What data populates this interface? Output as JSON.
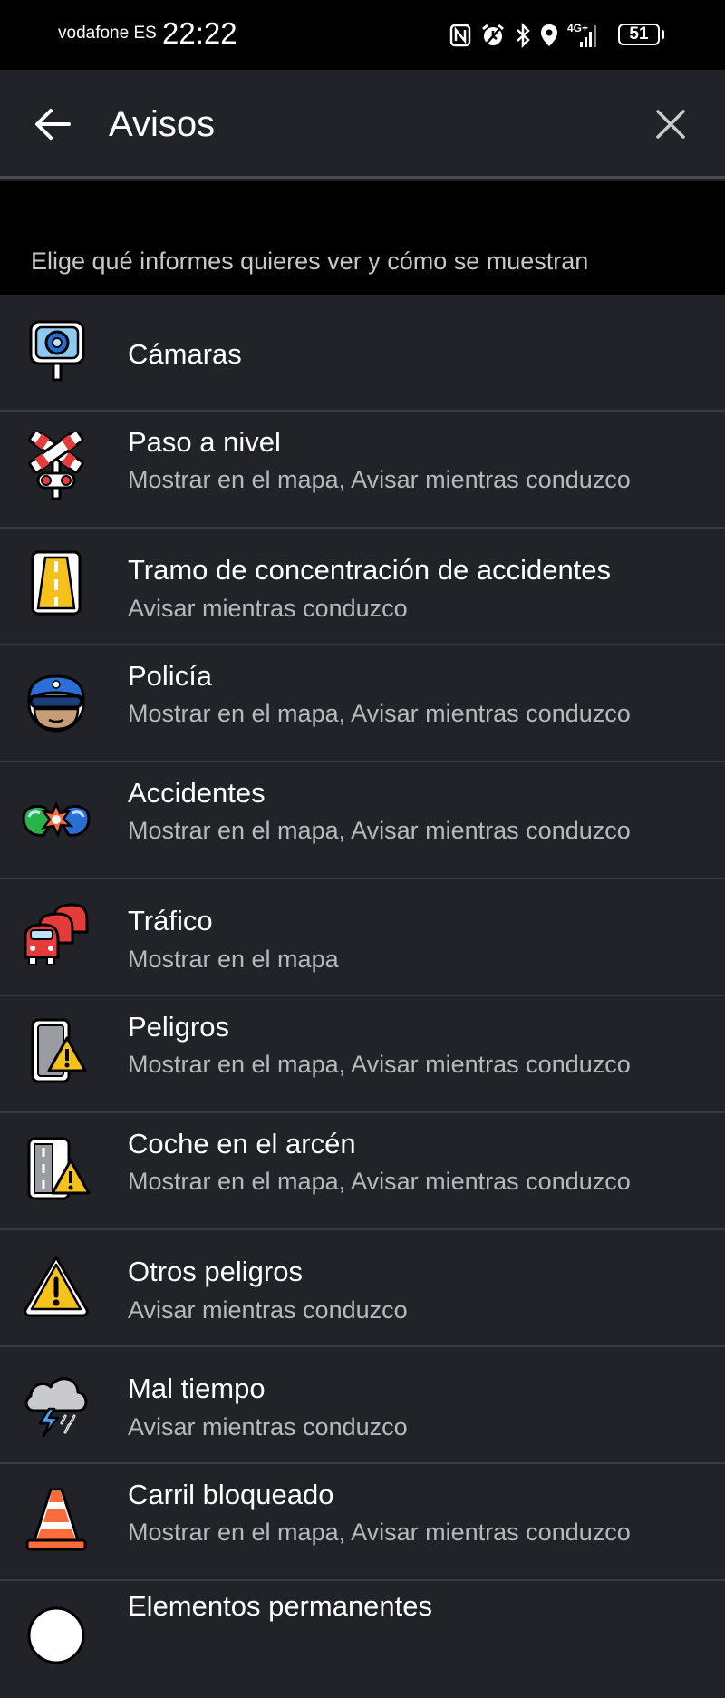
{
  "status_bar": {
    "carrier": "vodafone ES",
    "time": "22:22",
    "network": "4G+",
    "battery": "51",
    "icons": [
      "nfc-icon",
      "alarm-icon",
      "bluetooth-icon",
      "location-icon",
      "signal-icon",
      "battery-icon"
    ]
  },
  "header": {
    "title": "Avisos",
    "back_icon": "arrow-left-icon",
    "close_icon": "close-icon"
  },
  "description": "Elige qué informes quieres ver y cómo se muestran",
  "items": [
    {
      "label": "Cámaras",
      "subtitle": "",
      "icon": "speed-camera-icon"
    },
    {
      "label": "Paso a nivel",
      "subtitle": "Mostrar en el mapa, Avisar mientras conduzco",
      "icon": "railway-crossing-icon"
    },
    {
      "label": "Tramo de concentración de accidentes",
      "subtitle": "Avisar mientras conduzco",
      "icon": "accident-zone-road-icon"
    },
    {
      "label": "Policía",
      "subtitle": "Mostrar en el mapa, Avisar mientras conduzco",
      "icon": "police-icon"
    },
    {
      "label": "Accidentes",
      "subtitle": "Mostrar en el mapa, Avisar mientras conduzco",
      "icon": "car-crash-icon"
    },
    {
      "label": "Tráfico",
      "subtitle": "Mostrar en el mapa",
      "icon": "traffic-cars-icon"
    },
    {
      "label": "Peligros",
      "subtitle": "Mostrar en el mapa, Avisar mientras conduzco",
      "icon": "road-hazard-icon"
    },
    {
      "label": "Coche en el arcén",
      "subtitle": "Mostrar en el mapa, Avisar mientras conduzco",
      "icon": "car-on-shoulder-icon"
    },
    {
      "label": "Otros peligros",
      "subtitle": "Avisar mientras conduzco",
      "icon": "warning-triangle-icon"
    },
    {
      "label": "Mal tiempo",
      "subtitle": "Avisar mientras conduzco",
      "icon": "storm-cloud-icon"
    },
    {
      "label": "Carril bloqueado",
      "subtitle": "Mostrar en el mapa, Avisar mientras conduzco",
      "icon": "traffic-cone-icon"
    },
    {
      "label": "Elementos permanentes",
      "subtitle": "",
      "icon": "permanent-element-icon"
    }
  ],
  "colors": {
    "background": "#222328",
    "status_bar": "#000000",
    "divider": "#3a3b40",
    "subtitle_text": "#b7b8bc"
  }
}
